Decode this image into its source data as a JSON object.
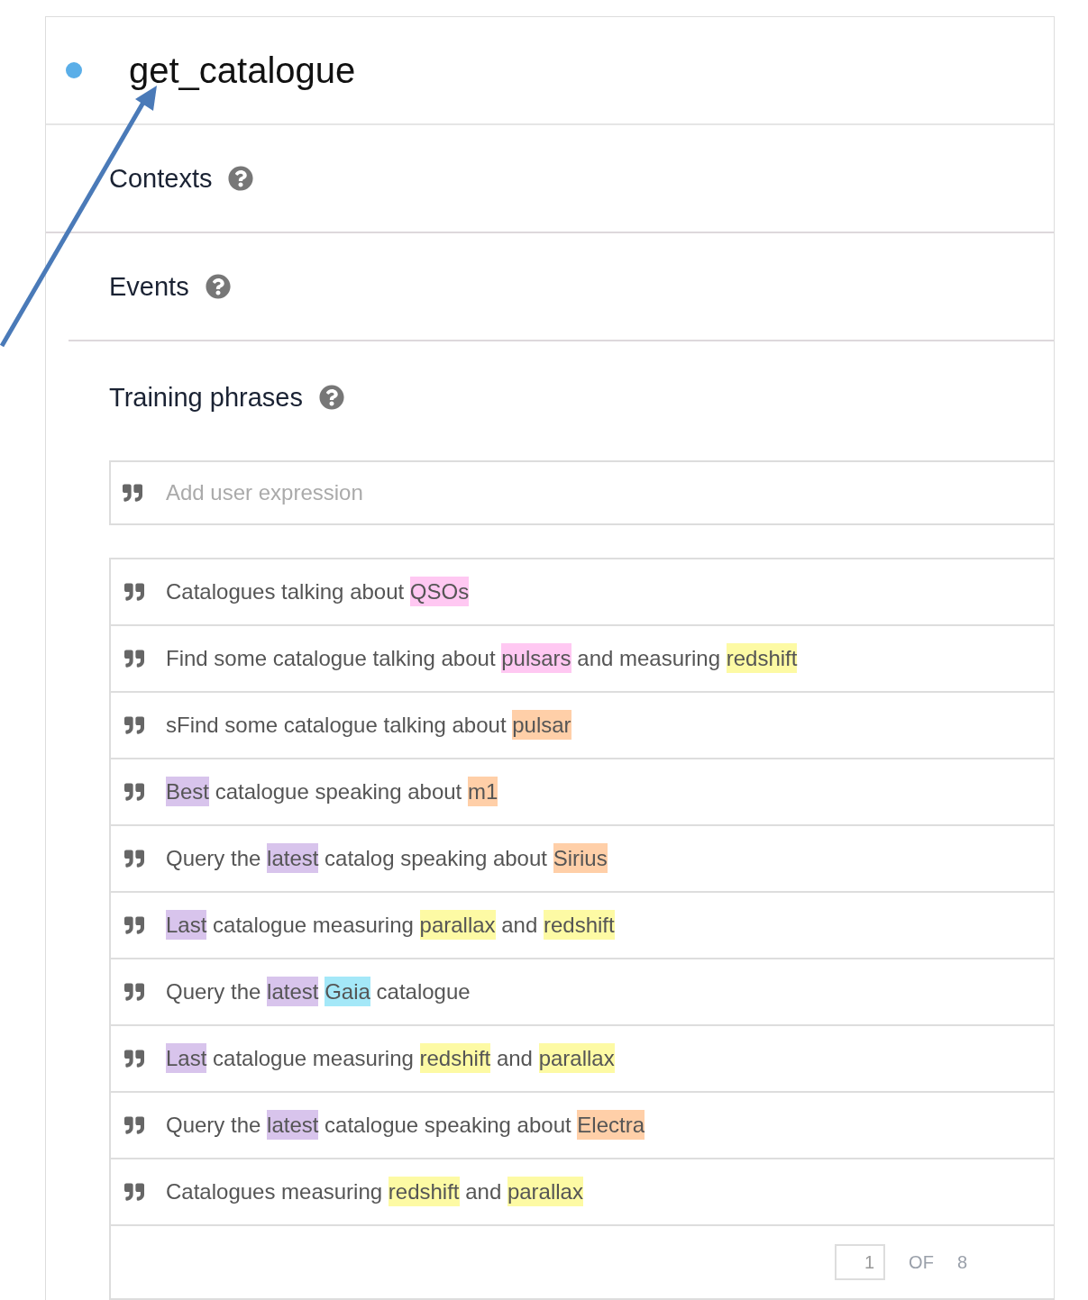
{
  "intent": {
    "title": "get_catalogue"
  },
  "sections": [
    {
      "title": "Contexts"
    },
    {
      "title": "Events"
    },
    {
      "title": "Training phrases"
    }
  ],
  "expression_input": {
    "placeholder": "Add user expression"
  },
  "phrases": [
    {
      "segments": [
        {
          "text": "Catalogues talking about "
        },
        {
          "text": "QSOs",
          "color": "#ffc8f2"
        }
      ]
    },
    {
      "segments": [
        {
          "text": "Find some catalogue talking about "
        },
        {
          "text": "pulsars",
          "color": "#ffc8f2"
        },
        {
          "text": " and measuring "
        },
        {
          "text": "redshift",
          "color": "#fdfaa4"
        }
      ]
    },
    {
      "segments": [
        {
          "text": "sFind some catalogue talking about "
        },
        {
          "text": "pulsar",
          "color": "#ffcfa8"
        }
      ]
    },
    {
      "segments": [
        {
          "text": "Best",
          "color": "#d8c4ec"
        },
        {
          "text": " catalogue speaking about "
        },
        {
          "text": "m1",
          "color": "#ffcfa8"
        }
      ]
    },
    {
      "segments": [
        {
          "text": "Query the "
        },
        {
          "text": "latest",
          "color": "#d8c4ec"
        },
        {
          "text": " catalog speaking about "
        },
        {
          "text": "Sirius",
          "color": "#ffcfa8"
        }
      ]
    },
    {
      "segments": [
        {
          "text": "Last",
          "color": "#d8c4ec"
        },
        {
          "text": " catalogue measuring "
        },
        {
          "text": "parallax",
          "color": "#fdfaa4"
        },
        {
          "text": " and "
        },
        {
          "text": "redshift",
          "color": "#fdfaa4"
        }
      ]
    },
    {
      "segments": [
        {
          "text": "Query the "
        },
        {
          "text": "latest",
          "color": "#d8c4ec"
        },
        {
          "text": "Gaia",
          "color": "#a4e8f8"
        },
        {
          "text": " catalogue"
        }
      ]
    },
    {
      "segments": [
        {
          "text": "Last",
          "color": "#d8c4ec"
        },
        {
          "text": " catalogue measuring "
        },
        {
          "text": "redshift",
          "color": "#fdfaa4"
        },
        {
          "text": " and "
        },
        {
          "text": "parallax",
          "color": "#fdfaa4"
        }
      ]
    },
    {
      "segments": [
        {
          "text": "Query the "
        },
        {
          "text": "latest",
          "color": "#d8c4ec"
        },
        {
          "text": " catalogue speaking about "
        },
        {
          "text": "Electra",
          "color": "#ffcfa8"
        }
      ]
    },
    {
      "segments": [
        {
          "text": "Catalogues measuring "
        },
        {
          "text": "redshift",
          "color": "#fdfaa4"
        },
        {
          "text": " and "
        },
        {
          "text": "parallax",
          "color": "#fdfaa4"
        }
      ]
    }
  ],
  "pagination": {
    "page": "1",
    "of_label": "OF",
    "total": "8"
  }
}
